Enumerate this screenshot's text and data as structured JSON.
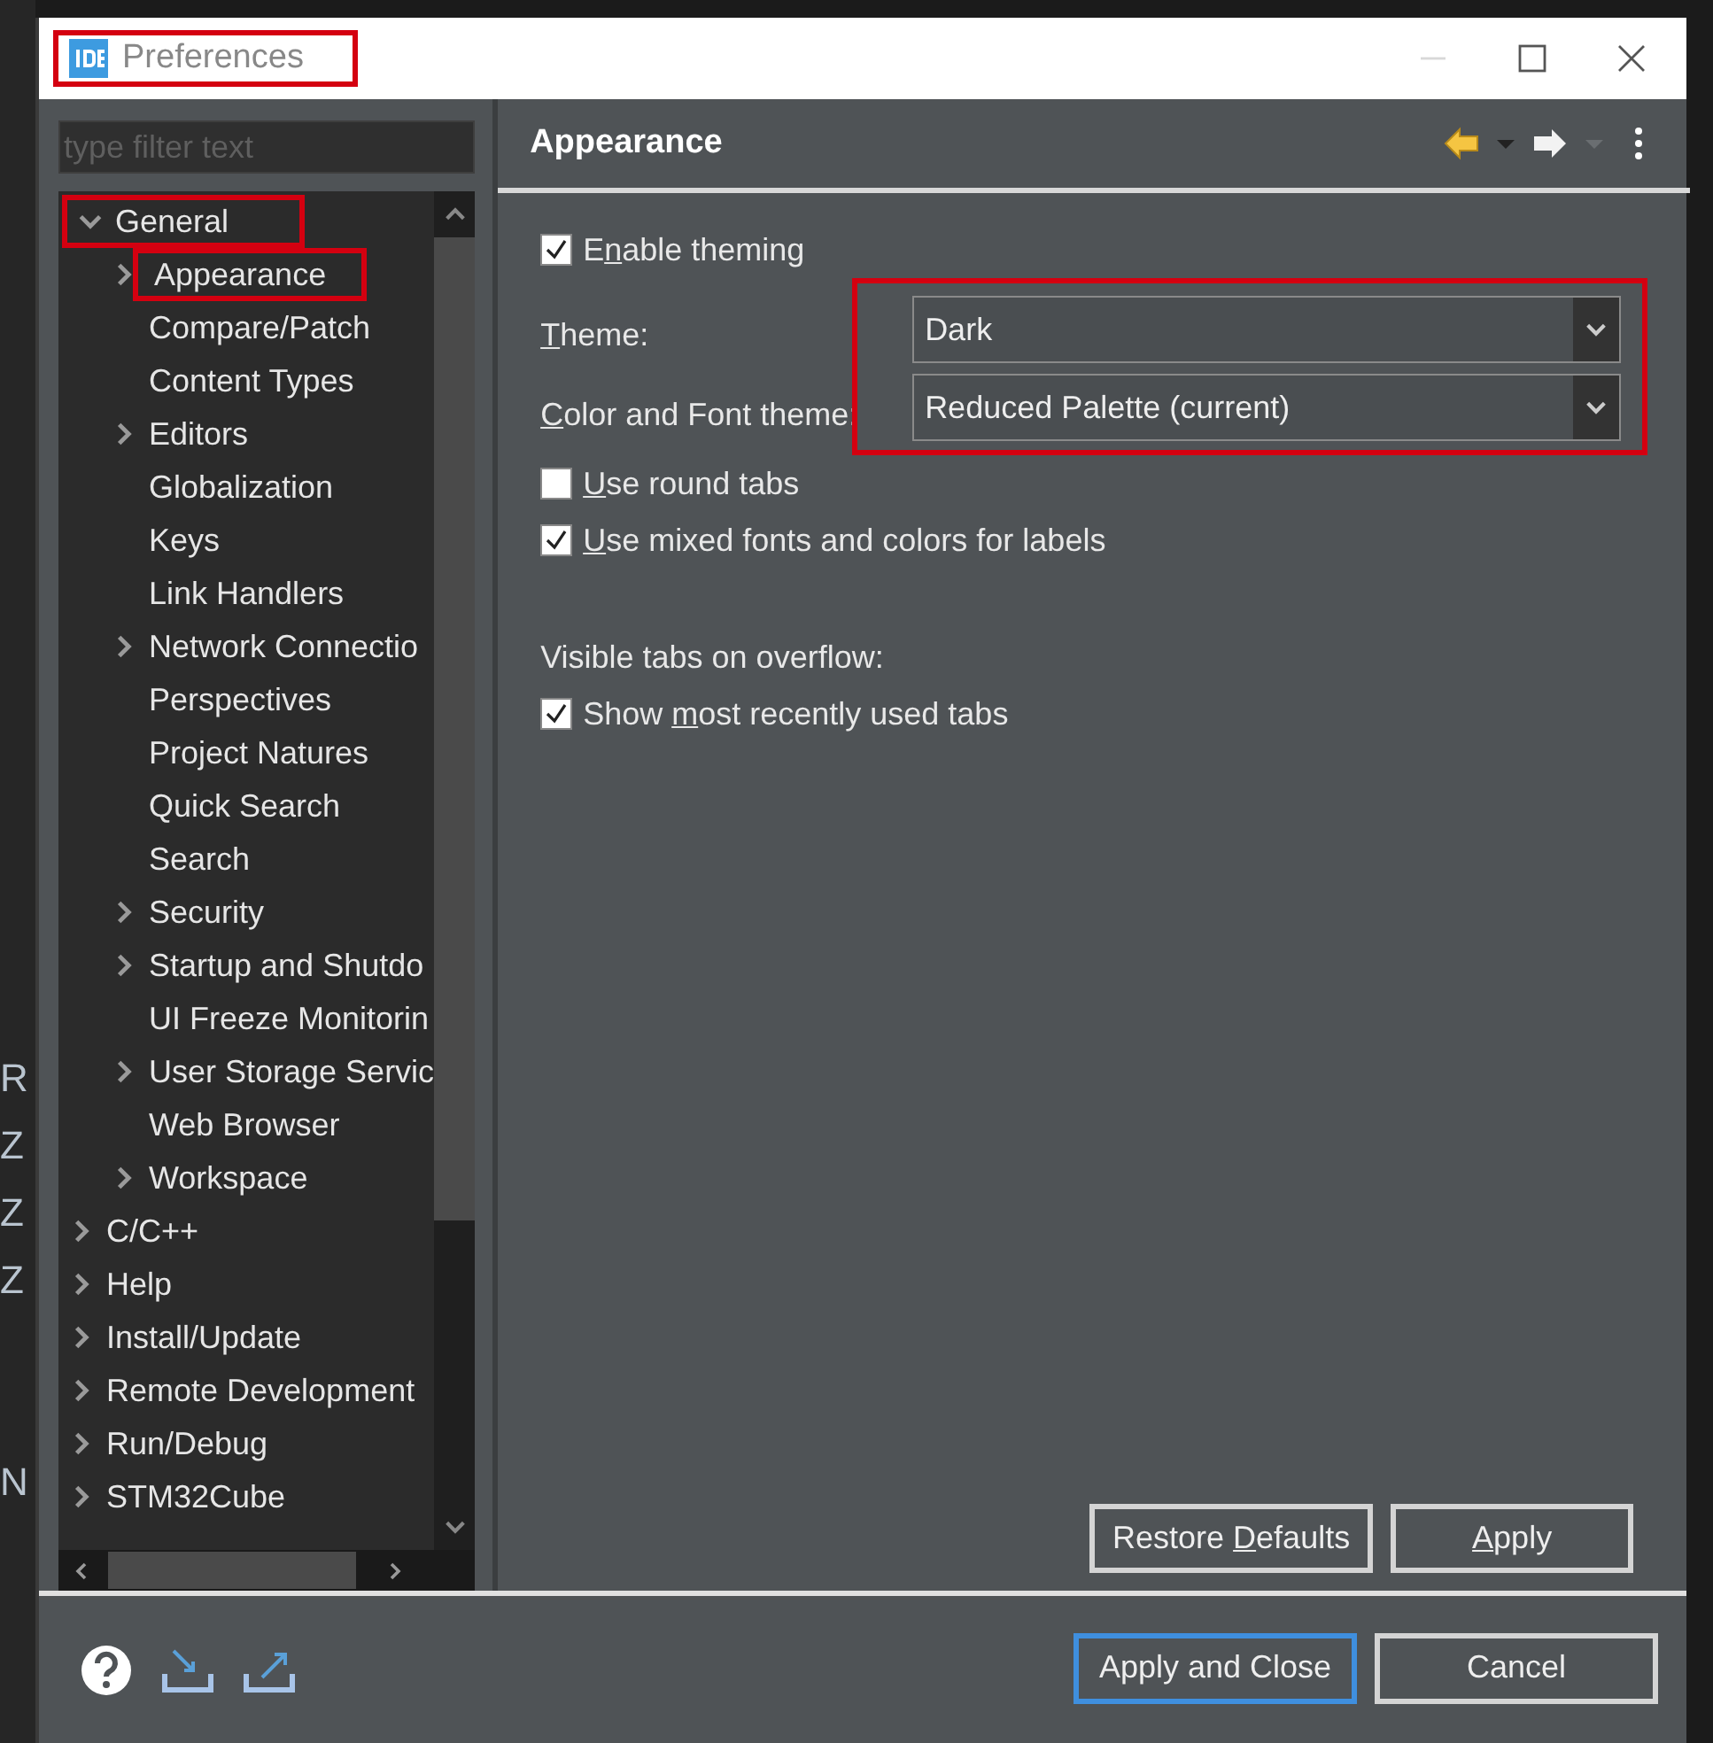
{
  "background": {
    "letters": [
      "R",
      "Z",
      "Z",
      "Z",
      "N"
    ]
  },
  "window": {
    "title": "Preferences"
  },
  "sidebar": {
    "filter": {
      "placeholder": "type filter text"
    },
    "tree": [
      {
        "label": "General",
        "kind": "folder",
        "expanded": true,
        "highlighted": true,
        "children": [
          {
            "label": "Appearance",
            "kind": "folder",
            "expanded": false,
            "highlighted": true
          },
          {
            "label": "Compare/Patch",
            "kind": "leaf",
            "highlighted": false
          },
          {
            "label": "Content Types",
            "kind": "leaf",
            "highlighted": false
          },
          {
            "label": "Editors",
            "kind": "folder",
            "expanded": false,
            "highlighted": false
          },
          {
            "label": "Globalization",
            "kind": "leaf",
            "highlighted": false
          },
          {
            "label": "Keys",
            "kind": "leaf",
            "highlighted": false
          },
          {
            "label": "Link Handlers",
            "kind": "leaf",
            "highlighted": false
          },
          {
            "label": "Network Connectio",
            "kind": "folder",
            "expanded": false,
            "highlighted": false
          },
          {
            "label": "Perspectives",
            "kind": "leaf",
            "highlighted": false
          },
          {
            "label": "Project Natures",
            "kind": "leaf",
            "highlighted": false
          },
          {
            "label": "Quick Search",
            "kind": "leaf",
            "highlighted": false
          },
          {
            "label": "Search",
            "kind": "leaf",
            "highlighted": false
          },
          {
            "label": "Security",
            "kind": "folder",
            "expanded": false,
            "highlighted": false
          },
          {
            "label": "Startup and Shutdo",
            "kind": "folder",
            "expanded": false,
            "highlighted": false
          },
          {
            "label": "UI Freeze Monitorin",
            "kind": "leaf",
            "highlighted": false
          },
          {
            "label": "User Storage Servic",
            "kind": "folder",
            "expanded": false,
            "highlighted": false
          },
          {
            "label": "Web Browser",
            "kind": "leaf",
            "highlighted": false
          },
          {
            "label": "Workspace",
            "kind": "folder",
            "expanded": false,
            "highlighted": false
          }
        ]
      },
      {
        "label": "C/C++",
        "kind": "folder",
        "expanded": false,
        "highlighted": false
      },
      {
        "label": "Help",
        "kind": "folder",
        "expanded": false,
        "highlighted": false
      },
      {
        "label": "Install/Update",
        "kind": "folder",
        "expanded": false,
        "highlighted": false
      },
      {
        "label": "Remote Development",
        "kind": "folder",
        "expanded": false,
        "highlighted": false
      },
      {
        "label": "Run/Debug",
        "kind": "folder",
        "expanded": false,
        "highlighted": false
      },
      {
        "label": "STM32Cube",
        "kind": "folder",
        "expanded": false,
        "highlighted": false
      }
    ]
  },
  "page": {
    "title": "Appearance",
    "settings": [
      {
        "kind": "checkbox",
        "label": {
          "pre": "E",
          "key": "n",
          "post": "able theming"
        },
        "checked": true
      },
      {
        "kind": "combo",
        "label": {
          "key": "T",
          "post": "heme:"
        },
        "value": "Dark"
      },
      {
        "kind": "combo",
        "label": {
          "key": "C",
          "post": "olor and Font theme:"
        },
        "value": "Reduced Palette (current)"
      },
      {
        "kind": "checkbox",
        "label": {
          "key": "U",
          "post": "se round tabs"
        },
        "checked": false
      },
      {
        "kind": "checkbox",
        "label": {
          "key": "U",
          "post": "se mixed fonts and colors for labels"
        },
        "checked": true
      },
      {
        "kind": "heading",
        "label": {
          "post": "Visible tabs on overflow:"
        }
      },
      {
        "kind": "checkbox",
        "label": {
          "pre": "Show ",
          "key": "m",
          "post": "ost recently used tabs"
        },
        "checked": true
      }
    ],
    "buttons": [
      {
        "label": {
          "pre": "Restore ",
          "key": "D",
          "post": "efaults"
        }
      },
      {
        "label": {
          "key": "A",
          "post": "pply"
        }
      }
    ]
  },
  "footer": {
    "buttons": [
      {
        "label": "Apply and Close",
        "default": true
      },
      {
        "label": "Cancel",
        "default": false
      }
    ]
  }
}
